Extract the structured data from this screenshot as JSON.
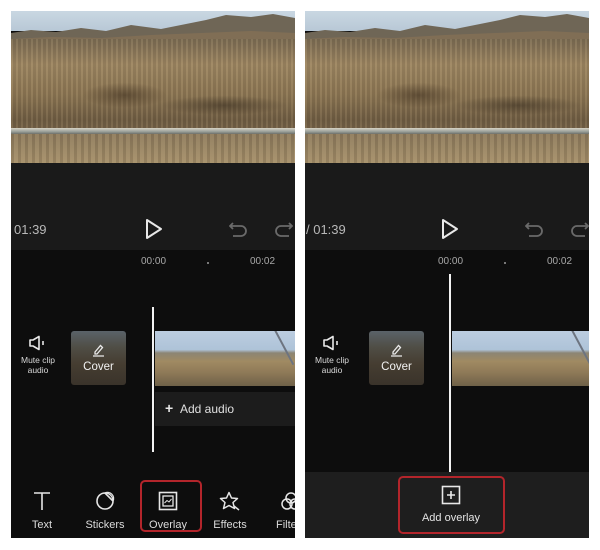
{
  "left_panel": {
    "controls": {
      "time": "01:39",
      "play_icon": "play-icon",
      "undo_icon": "undo-icon",
      "redo_icon": "redo-icon"
    },
    "ruler": {
      "labels": [
        "00:00",
        "00:02"
      ]
    },
    "timeline": {
      "mute_label_line1": "Mute clip",
      "mute_label_line2": "audio",
      "cover_label": "Cover",
      "add_audio_label": "Add audio"
    },
    "toolbar": {
      "items": [
        {
          "label": "Text",
          "icon": "text-icon"
        },
        {
          "label": "Stickers",
          "icon": "sticker-icon"
        },
        {
          "label": "Overlay",
          "icon": "overlay-icon",
          "highlighted": true
        },
        {
          "label": "Effects",
          "icon": "effects-star-icon"
        },
        {
          "label": "Filters",
          "icon": "filters-icon"
        }
      ]
    }
  },
  "right_panel": {
    "controls": {
      "time": "/ 01:39",
      "play_icon": "play-icon",
      "undo_icon": "undo-icon",
      "redo_icon": "redo-icon"
    },
    "ruler": {
      "labels": [
        "00:00",
        "00:02"
      ]
    },
    "timeline": {
      "mute_label_line1": "Mute clip",
      "mute_label_line2": "audio",
      "cover_label": "Cover"
    },
    "bottom_bar": {
      "add_overlay_label": "Add overlay",
      "highlighted": true
    }
  },
  "colors": {
    "highlight": "#b3252b",
    "background": "#0d0d0d",
    "control_bar": "#1a1a1a",
    "bottom_bar": "#1e1e1e"
  }
}
